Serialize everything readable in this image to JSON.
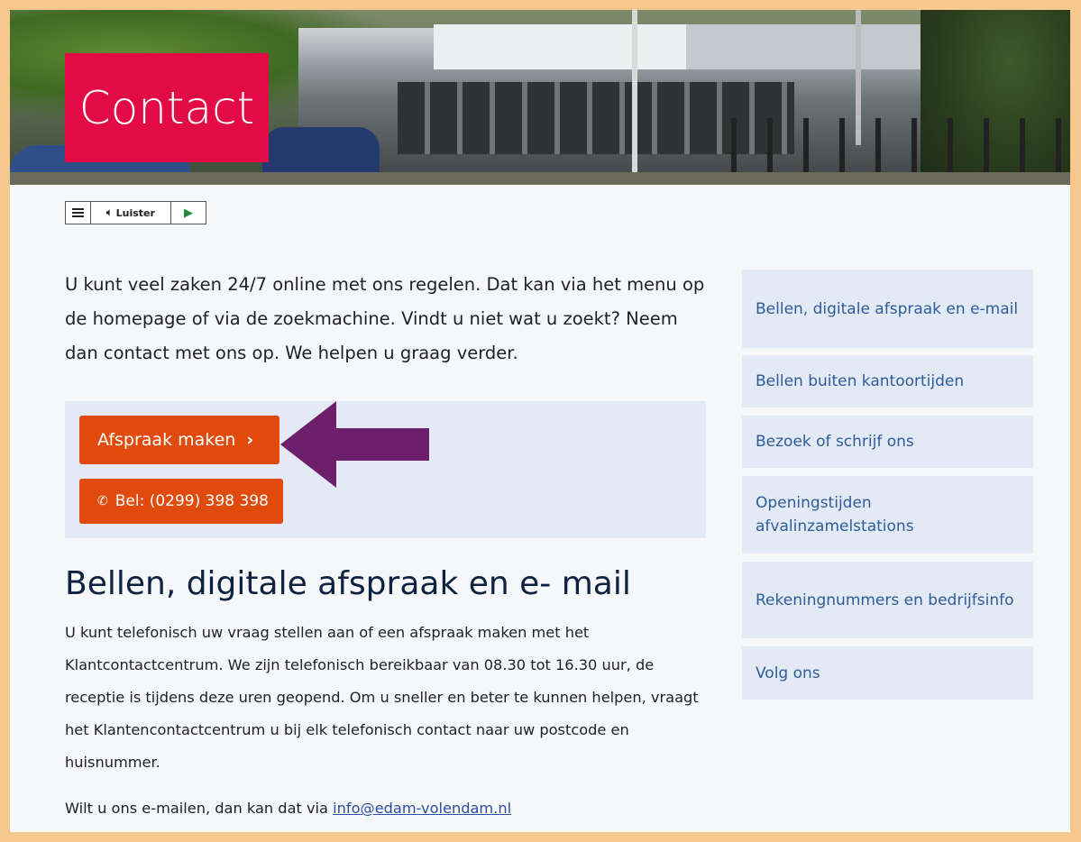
{
  "header": {
    "title": "Contact"
  },
  "listen_bar": {
    "listen_label": "Luister"
  },
  "intro": {
    "text": "U kunt veel zaken 24/7 online met ons regelen. Dat kan via het menu op de homepage of via de zoekmachine. Vindt u niet wat u zoekt? Neem dan contact met ons op. We helpen u graag verder."
  },
  "cta": {
    "appointment_label": "Afspraak maken",
    "call_label": "Bel: (0299) 398 398"
  },
  "section": {
    "heading": "Bellen, digitale afspraak en e- mail",
    "body": "U kunt telefonisch uw vraag stellen aan of een afspraak maken met het Klantcontactcentrum. We zijn telefonisch bereikbaar van 08.30 tot 16.30 uur, de receptie is tijdens deze uren geopend. Om u sneller en beter te kunnen helpen, vraagt het Klantencontactcentrum u bij elk telefonisch contact naar uw postcode en huisnummer.",
    "mail_prefix": "Wilt u ons e-mailen, dan kan dat via",
    "mail_link": "info@edam-volendam.nl"
  },
  "sidebar": {
    "items": [
      {
        "label": "Bellen, digitale afspraak en e-mail"
      },
      {
        "label": "Bellen buiten kantoortijden"
      },
      {
        "label": "Bezoek of schrijf ons"
      },
      {
        "label": "Openingstijden afvalinzamelstations"
      },
      {
        "label": "Rekeningnummers en bedrijfsinfo"
      },
      {
        "label": "Volg ons"
      }
    ]
  },
  "colors": {
    "brand_red": "#e30b45",
    "button_orange": "#e04a0d",
    "panel_blue": "#e3eaf5",
    "link_blue": "#2e5c9a",
    "arrow_purple": "#6e1f6c",
    "frame_peach": "#f7c88e"
  }
}
